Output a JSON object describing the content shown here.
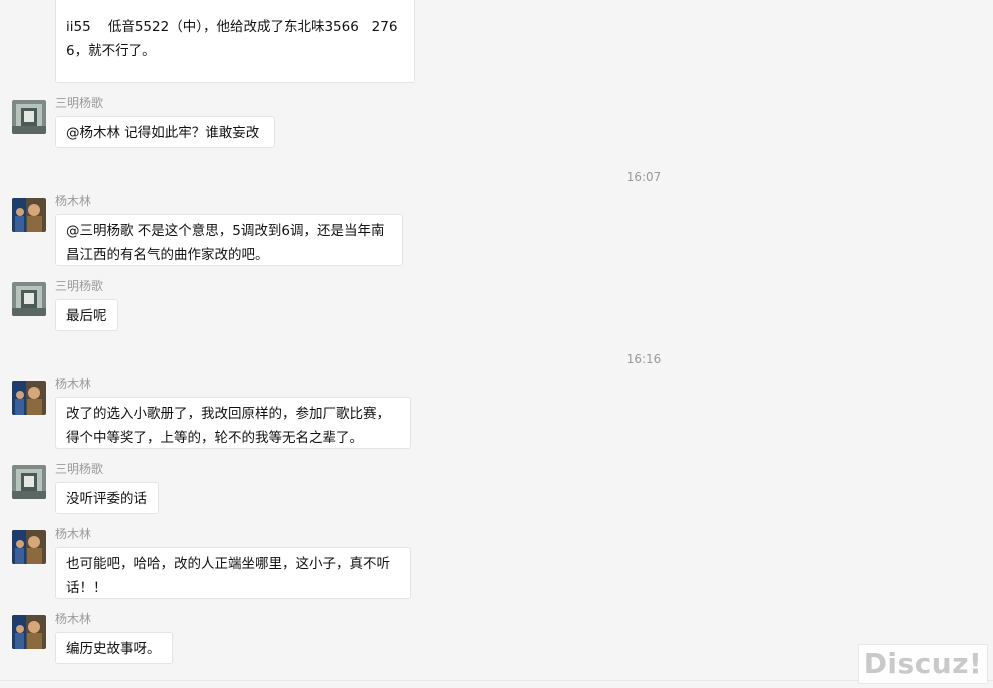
{
  "messages": [
    {
      "text": "ii55    低音5522（中），他给改成了东北味3566   2766，就不行了。"
    },
    {
      "sender": "三明杨歌",
      "text": "@杨木林 记得如此牢？谁敢妄改"
    },
    {
      "sender": "杨木林",
      "text": "@三明杨歌 不是这个意思，5调改到6调，还是当年南昌江西的有名气的曲作家改的吧。"
    },
    {
      "sender": "三明杨歌",
      "text": "最后呢"
    },
    {
      "sender": "杨木林",
      "text": "改了的选入小歌册了，我改回原样的，参加厂歌比赛，得个中等奖了，上等的，轮不的我等无名之辈了。"
    },
    {
      "sender": "三明杨歌",
      "text": "没听评委的话"
    },
    {
      "sender": "杨木林",
      "text": "也可能吧，哈哈，改的人正端坐哪里，这小子，真不听话！！"
    },
    {
      "sender": "杨木林",
      "text": "编历史故事呀。"
    }
  ],
  "timestamps": [
    "16:07",
    "16:16"
  ],
  "watermark": "Discuz!",
  "avatars": {
    "sanming": "avatar-sanming-yangge",
    "yangmulin": "avatar-yang-mulin"
  }
}
